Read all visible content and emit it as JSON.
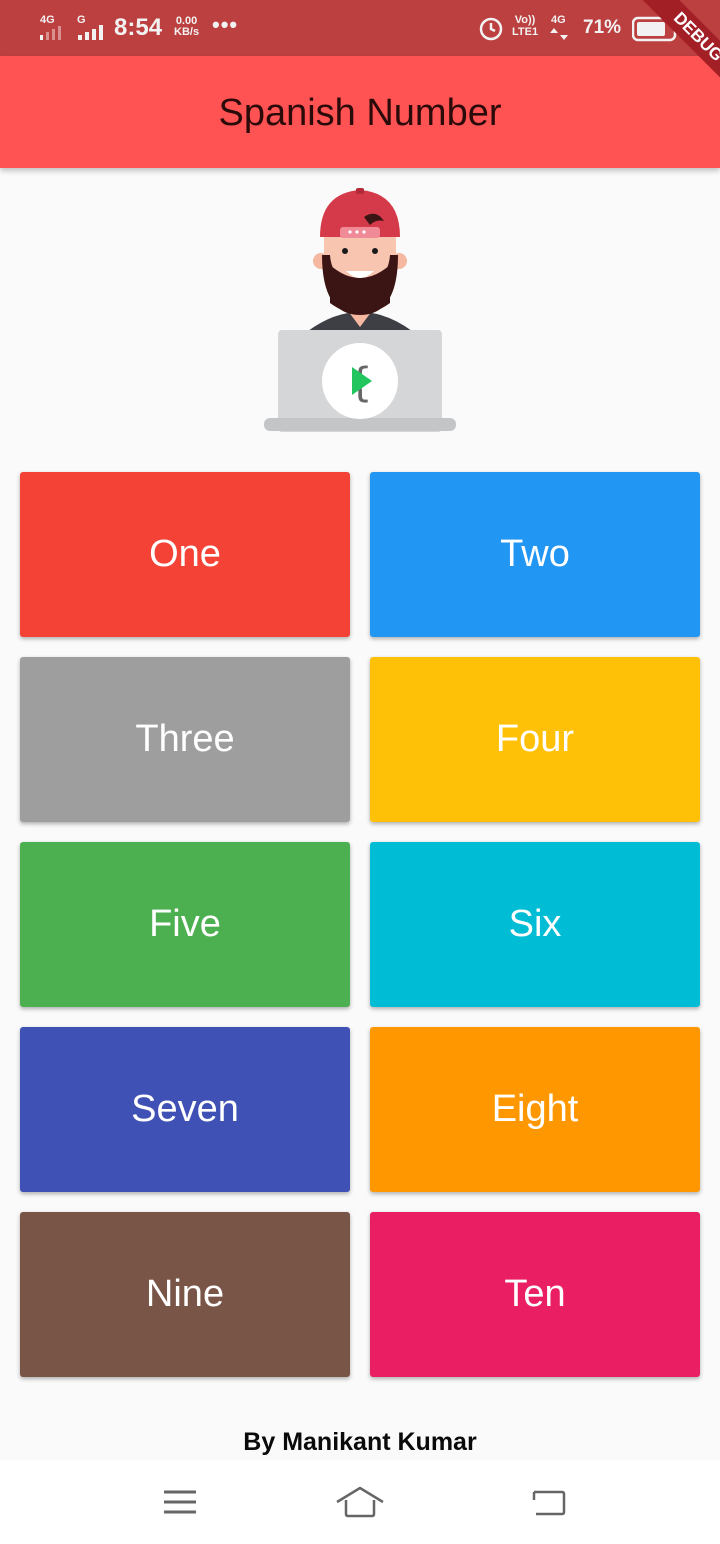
{
  "status_bar": {
    "net1": "4G",
    "net2": "G",
    "time": "8:54",
    "speed_value": "0.00",
    "speed_unit": "KB/s",
    "more": "•••",
    "volte": "Vo))",
    "lte": "LTE1",
    "net3": "4G",
    "battery": "71%"
  },
  "app_bar": {
    "title": "Spanish Number"
  },
  "debug_banner": {
    "label": "DEBUG"
  },
  "numbers": [
    {
      "label": "One",
      "color": "#f44336"
    },
    {
      "label": "Two",
      "color": "#2196f3"
    },
    {
      "label": "Three",
      "color": "#9e9e9e"
    },
    {
      "label": "Four",
      "color": "#ffc107"
    },
    {
      "label": "Five",
      "color": "#4caf50"
    },
    {
      "label": "Six",
      "color": "#00bcd4"
    },
    {
      "label": "Seven",
      "color": "#3f51b5"
    },
    {
      "label": "Eight",
      "color": "#ff9800"
    },
    {
      "label": "Nine",
      "color": "#795548"
    },
    {
      "label": "Ten",
      "color": "#e91e63"
    }
  ],
  "footer": {
    "credit": "By Manikant Kumar"
  },
  "nav": {
    "menu_icon": "menu-icon",
    "home_icon": "home-icon",
    "back_icon": "back-icon"
  }
}
